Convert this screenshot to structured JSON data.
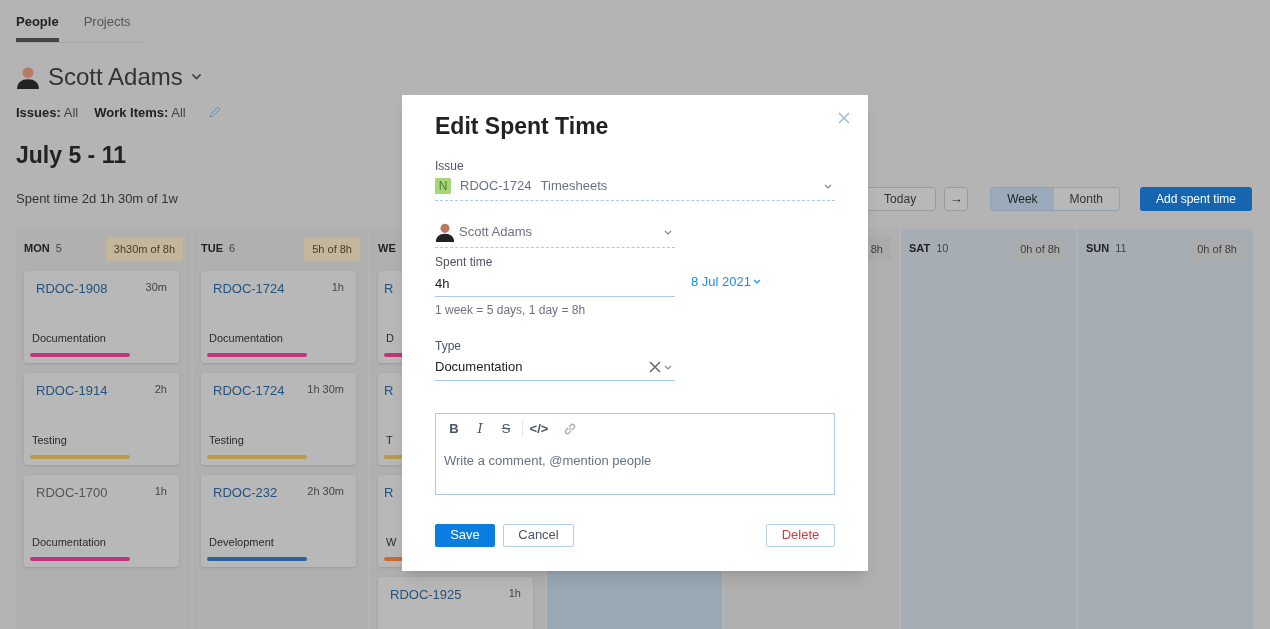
{
  "tabs": [
    {
      "label": "People",
      "selected": true
    },
    {
      "label": "Projects",
      "selected": false
    }
  ],
  "person": {
    "name": "Scott Adams"
  },
  "filters": [
    {
      "label": "Issues:",
      "value": "All"
    },
    {
      "label": "Work Items:",
      "value": "All"
    }
  ],
  "period": "July 5 - 11",
  "summary": "Spent time 2d 1h 30m of 1w",
  "toolbar": {
    "today": "Today",
    "next": "→",
    "views": [
      {
        "label": "Week",
        "selected": true
      },
      {
        "label": "Month",
        "selected": false
      }
    ],
    "add": "Add spent time"
  },
  "days": [
    {
      "name": "MON",
      "date": "5",
      "total": "3h30m of 8h",
      "kind": "workday",
      "cards": [
        {
          "id": "RDOC-1908",
          "time": "30m",
          "type": "Documentation",
          "color": "#c2347a",
          "resolved": false
        },
        {
          "id": "RDOC-1914",
          "time": "2h",
          "type": "Testing",
          "color": "#b89a4c",
          "resolved": false
        },
        {
          "id": "RDOC-1700",
          "time": "1h",
          "type": "Documentation",
          "color": "#c2347a",
          "resolved": true
        }
      ]
    },
    {
      "name": "TUE",
      "date": "6",
      "total": "5h of 8h",
      "kind": "workday",
      "cards": [
        {
          "id": "RDOC-1724",
          "time": "1h",
          "type": "Documentation",
          "color": "#c2347a",
          "resolved": false
        },
        {
          "id": "RDOC-1724",
          "time": "1h 30m",
          "type": "Testing",
          "color": "#b89a4c",
          "resolved": false
        },
        {
          "id": "RDOC-232",
          "time": "2h 30m",
          "type": "Development",
          "color": "#2f5f98",
          "resolved": false
        }
      ]
    },
    {
      "name": "WE",
      "kind": "workday",
      "cards": [
        {
          "id": "R",
          "type": "D",
          "color": "#c2347a",
          "resolved": false
        },
        {
          "id": "R",
          "type": "T",
          "color": "#b89a4c",
          "resolved": false
        },
        {
          "id": "R",
          "type": "W",
          "color": "#c96a34",
          "resolved": false
        },
        {
          "id": "RDOC-1925",
          "time": "1h",
          "resolved": false
        }
      ]
    },
    {
      "kind": "today"
    },
    {
      "total": "8h",
      "kind": "hidden"
    },
    {
      "name": "SAT",
      "date": "10",
      "total": "0h of 8h",
      "kind": "weekend"
    },
    {
      "name": "SUN",
      "date": "11",
      "total": "0h of 8h",
      "kind": "weekend"
    }
  ],
  "dialog": {
    "title": "Edit Spent Time",
    "issue": {
      "label": "Issue",
      "badge": "N",
      "id": "RDOC-1724",
      "summary": "Timesheets"
    },
    "author": {
      "name": "Scott Adams"
    },
    "spent": {
      "label": "Spent time",
      "value": "4h",
      "date": "8 Jul 2021",
      "hint": "1 week = 5 days, 1 day = 8h"
    },
    "type": {
      "label": "Type",
      "value": "Documentation"
    },
    "editor": {
      "tools": [
        {
          "kind": "bold",
          "label": "B"
        },
        {
          "kind": "italic",
          "label": "I"
        },
        {
          "kind": "strike",
          "label": "S"
        },
        {
          "kind": "code",
          "label": "</>"
        },
        {
          "kind": "link"
        }
      ],
      "placeholder": "Write a comment, @mention people"
    },
    "buttons": {
      "save": "Save",
      "cancel": "Cancel",
      "delete": "Delete"
    }
  }
}
